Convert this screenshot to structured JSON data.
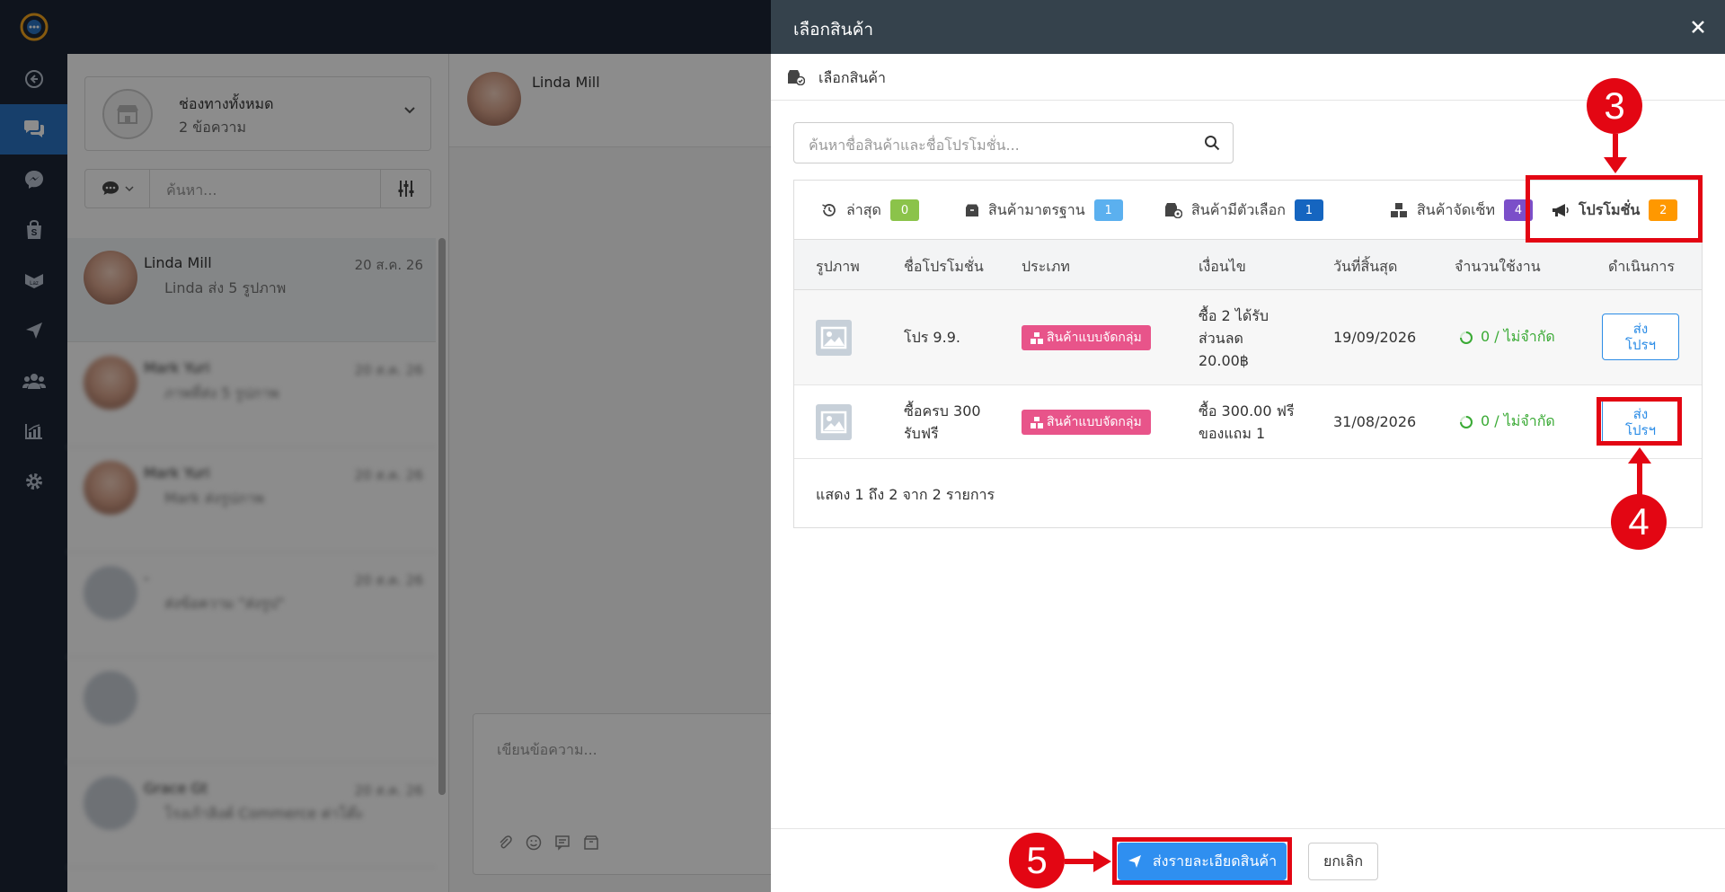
{
  "sidebar_nav": {
    "items": [
      "back-icon",
      "chat-icon",
      "messenger-icon",
      "shopping-bag-icon",
      "lazada-icon",
      "send-icon",
      "users-icon",
      "chart-icon",
      "gear-icon"
    ],
    "active_index": 1
  },
  "chat_list": {
    "channel_title": "ช่องทางทั้งหมด",
    "channel_subtitle": "2 ข้อความ",
    "search_placeholder": "ค้นหา...",
    "items": [
      {
        "name": "Linda Mill",
        "date": "20 ส.ค. 26",
        "message": "Linda ส่ง 5 รูปภาพ"
      },
      {
        "name": "Mark Yuri",
        "date": "20 ส.ค. 26",
        "message": "ภาพที่ส่ง 5 รูปภาพ"
      },
      {
        "name": "Mark Yuri",
        "date": "20 ส.ค. 26",
        "message": "Mark ส่งรูปภาพ"
      },
      {
        "name": "-",
        "date": "20 ส.ค. 26",
        "message": "ส่งข้อความ \"ส่งรูป\""
      },
      {
        "name": "",
        "date": "",
        "message": ""
      },
      {
        "name": "Grace Gt",
        "date": "20 ส.ค. 26",
        "message": "โรงเก้าลิงค์ Commerce ค่าโต๊ะ"
      }
    ]
  },
  "chat_pane": {
    "contact_name": "Linda Mill",
    "composer_placeholder": "เขียนข้อความ..."
  },
  "modal": {
    "title": "เลือกสินค้า",
    "subheader": "เลือกสินค้า",
    "search_placeholder": "ค้นหาชื่อสินค้าและชื่อโปรโมชั่น...",
    "tabs": [
      {
        "label": "ล่าสุด",
        "count": "0",
        "color": "#8bc34a"
      },
      {
        "label": "สินค้ามาตรฐาน",
        "count": "1",
        "color": "#5bb0ef"
      },
      {
        "label": "สินค้ามีตัวเลือก",
        "count": "1",
        "color": "#1565c0"
      },
      {
        "label": "สินค้าจัดเซ็ท",
        "count": "4",
        "color": "#7b4fc9"
      },
      {
        "label": "โปรโมชั่น",
        "count": "2",
        "color": "#ff9800"
      }
    ],
    "columns": [
      "รูปภาพ",
      "ชื่อโปรโมชั่น",
      "ประเภท",
      "เงื่อนไข",
      "วันที่สิ้นสุด",
      "จำนวนใช้งาน",
      "ดำเนินการ"
    ],
    "rows": [
      {
        "name": "โปร 9.9.",
        "type": "สินค้าแบบจัดกลุ่ม",
        "condition_lines": [
          "ซื้อ 2 ได้รับ",
          "ส่วนลด",
          "20.00฿"
        ],
        "end_date": "19/09/2026",
        "usage": "0 / ไม่จำกัด",
        "action_lines": [
          "ส่ง",
          "โปรฯ"
        ]
      },
      {
        "name_lines": [
          "ซื้อครบ 300",
          "รับฟรี"
        ],
        "type": "สินค้าแบบจัดกลุ่ม",
        "condition_lines": [
          "ซื้อ 300.00 ฟรี",
          "ของแถม 1"
        ],
        "end_date": "31/08/2026",
        "usage": "0 / ไม่จำกัด",
        "action_lines": [
          "ส่ง",
          "โปรฯ"
        ]
      }
    ],
    "summary": "แสดง 1 ถึง 2 จาก 2 รายการ",
    "primary_button": "ส่งรายละเอียดสินค้า",
    "cancel_button": "ยกเลิก"
  },
  "annotations": {
    "steps": [
      "3",
      "4",
      "5"
    ],
    "color": "#e30613"
  }
}
